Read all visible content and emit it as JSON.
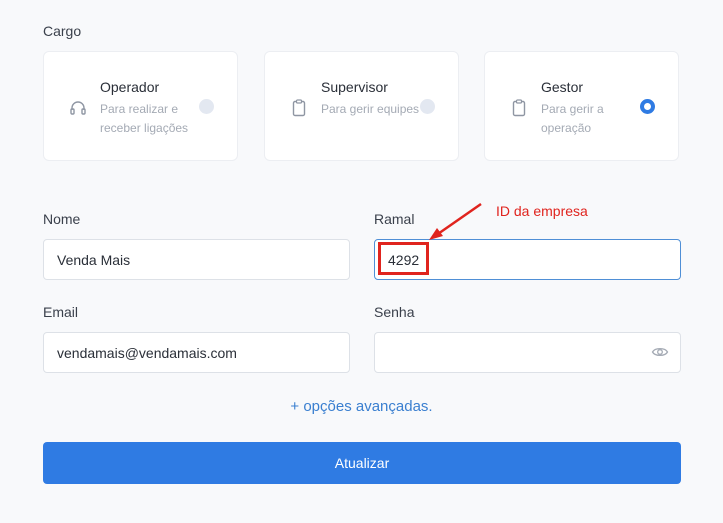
{
  "cargo": {
    "label": "Cargo",
    "options": [
      {
        "title": "Operador",
        "description": "Para realizar e receber ligações",
        "icon": "headset-icon",
        "selected": false
      },
      {
        "title": "Supervisor",
        "description": "Para gerir equipes",
        "icon": "clipboard-icon",
        "selected": false
      },
      {
        "title": "Gestor",
        "description": "Para gerir a operação",
        "icon": "clipboard-icon",
        "selected": true
      }
    ]
  },
  "form": {
    "nome": {
      "label": "Nome",
      "value": "Venda Mais"
    },
    "ramal": {
      "label": "Ramal",
      "value": "4292"
    },
    "email": {
      "label": "Email",
      "value": "vendamais@vendamais.com"
    },
    "senha": {
      "label": "Senha",
      "value": "",
      "icon": "eye-icon"
    }
  },
  "advanced_link": "+ opções avançadas.",
  "submit_label": "Atualizar",
  "annotation": {
    "text": "ID da empresa",
    "color": "#e0241e"
  },
  "colors": {
    "accent": "#2f7be3",
    "link": "#3a7fd0"
  }
}
